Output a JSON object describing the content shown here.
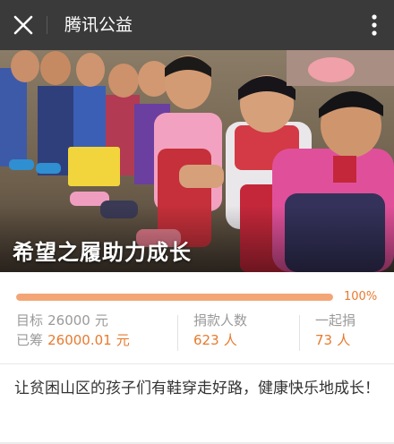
{
  "topbar": {
    "title": "腾讯公益",
    "close_icon": "close-icon",
    "more_icon": "more-vertical-icon",
    "background": "#3a3a3a"
  },
  "banner": {
    "title": "希望之履助力成长",
    "image": "photo of smiling children sitting in a row wearing new shoes"
  },
  "progress": {
    "percent_label": "100%",
    "fraction": 1.0,
    "color": "#f4a576"
  },
  "stats": {
    "target_label": "目标",
    "target_value": "26000",
    "target_unit": "元",
    "raised_label": "已筹",
    "raised_value": "26000.01",
    "raised_unit": "元",
    "donors_label": "捐款人数",
    "donors_value": "623",
    "donors_unit": "人",
    "together_label": "一起捐",
    "together_value": "73",
    "together_unit": "人",
    "accent": "#e87a2f"
  },
  "description": "让贫困山区的孩子们有鞋穿走好路，健康快乐地成长！"
}
